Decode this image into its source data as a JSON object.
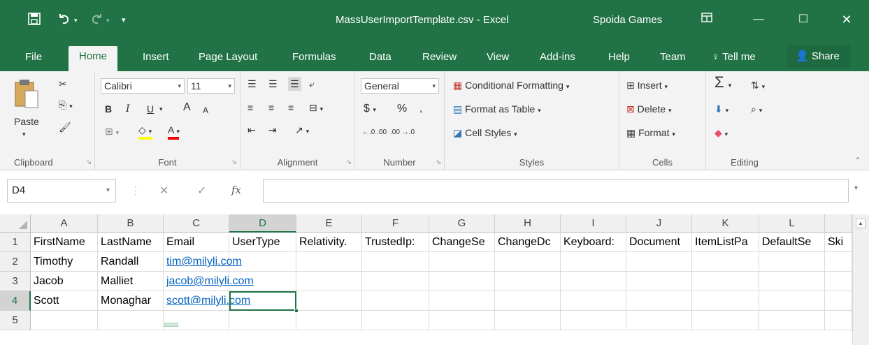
{
  "titlebar": {
    "qat": {
      "save_icon": "save-icon",
      "undo_icon": "undo-icon",
      "redo_icon": "redo-icon"
    },
    "title": "MassUserImportTemplate.csv - Excel",
    "user": "Spoida Games",
    "colors": {
      "brand": "#217346",
      "text": "#ffffff"
    }
  },
  "tabs": [
    {
      "label": "File"
    },
    {
      "label": "Home",
      "active": true
    },
    {
      "label": "Insert"
    },
    {
      "label": "Page Layout"
    },
    {
      "label": "Formulas"
    },
    {
      "label": "Data"
    },
    {
      "label": "Review"
    },
    {
      "label": "View"
    },
    {
      "label": "Add-ins"
    },
    {
      "label": "Help"
    },
    {
      "label": "Team"
    },
    {
      "label": "Tell me"
    }
  ],
  "share_label": "Share",
  "ribbon": {
    "clipboard": {
      "label": "Clipboard",
      "paste": "Paste"
    },
    "font": {
      "label": "Font",
      "font_name": "Calibri",
      "font_size": "11",
      "bold": "B",
      "italic": "I",
      "underline": "U",
      "grow": "A",
      "shrink": "A",
      "font_color": "A"
    },
    "alignment": {
      "label": "Alignment"
    },
    "number": {
      "label": "Number",
      "format": "General",
      "currency": "$",
      "percent": "%",
      "comma": ",",
      "inc": "←.0 .00",
      "dec": ".00 →.0"
    },
    "styles": {
      "label": "Styles",
      "conditional": "Conditional Formatting",
      "format_table": "Format as Table",
      "cell_styles": "Cell Styles"
    },
    "cells": {
      "label": "Cells",
      "insert": "Insert",
      "delete": "Delete",
      "format": "Format"
    },
    "editing": {
      "label": "Editing"
    }
  },
  "formula_bar": {
    "name_box": "D4",
    "fx": "fx",
    "value": ""
  },
  "grid": {
    "columns": [
      "A",
      "B",
      "C",
      "D",
      "E",
      "F",
      "G",
      "H",
      "I",
      "J",
      "K",
      "L"
    ],
    "selected_column": "D",
    "rows": [
      {
        "num": "1",
        "cells": [
          "FirstName",
          "LastName",
          "Email",
          "UserType",
          "Relativity.",
          "TrustedIp:",
          "ChangeSe",
          "ChangeDc",
          "Keyboard:",
          "Document",
          "ItemListPa",
          "DefaultSe",
          "Ski"
        ]
      },
      {
        "num": "2",
        "cells": [
          "Timothy",
          "Randall",
          "tim@milyli.com",
          "",
          "",
          "",
          "",
          "",
          "",
          "",
          "",
          "",
          ""
        ]
      },
      {
        "num": "3",
        "cells": [
          "Jacob",
          "Malliet",
          "jacob@milyli.com",
          "",
          "",
          "",
          "",
          "",
          "",
          "",
          "",
          "",
          ""
        ]
      },
      {
        "num": "4",
        "cells": [
          "Scott",
          "Monaghar",
          "scott@milyli.com",
          "",
          "",
          "",
          "",
          "",
          "",
          "",
          "",
          "",
          ""
        ]
      },
      {
        "num": "5",
        "cells": [
          "",
          "",
          "",
          "",
          "",
          "",
          "",
          "",
          "",
          "",
          "",
          "",
          ""
        ]
      }
    ],
    "selected_row": "4",
    "selected_cell": "D4"
  }
}
